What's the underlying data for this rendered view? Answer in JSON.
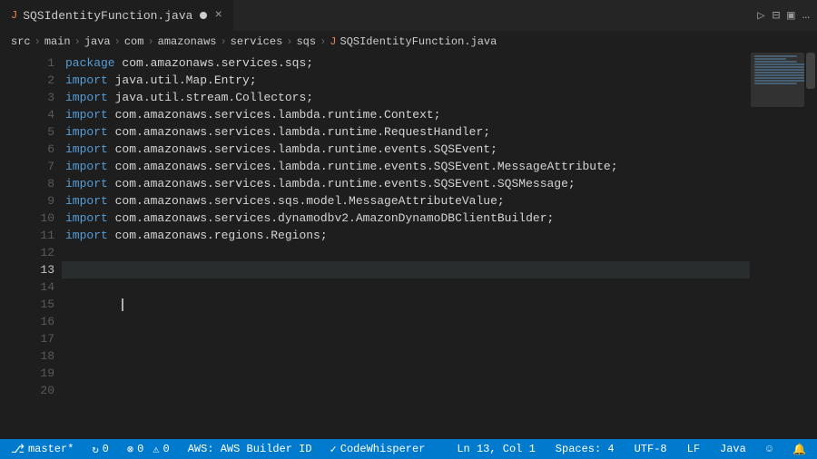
{
  "tab": {
    "filename": "SQSIdentityFunction.java",
    "modified": true,
    "language_icon": "J",
    "close_label": "×"
  },
  "breadcrumb": {
    "parts": [
      "src",
      "main",
      "java",
      "com",
      "amazonaws",
      "services",
      "sqs"
    ],
    "file": "SQSIdentityFunction.java",
    "separators": [
      ">",
      ">",
      ">",
      ">",
      ">",
      ">",
      ">",
      ">"
    ]
  },
  "toolbar": {
    "run_icon": "▷",
    "split_icon": "⊟",
    "layout_icon": "▣",
    "more_icon": "…"
  },
  "code": {
    "lines": [
      {
        "num": 1,
        "content": "package com.amazonaws.services.sqs;",
        "tokens": [
          {
            "t": "kw",
            "v": "package"
          },
          {
            "t": "plain",
            "v": " com.amazonaws.services.sqs;"
          }
        ]
      },
      {
        "num": 2,
        "content": "import java.util.Map.Entry;",
        "tokens": [
          {
            "t": "kw",
            "v": "import"
          },
          {
            "t": "plain",
            "v": " java.util.Map.Entry;"
          }
        ]
      },
      {
        "num": 3,
        "content": "import java.util.stream.Collectors;",
        "tokens": [
          {
            "t": "kw",
            "v": "import"
          },
          {
            "t": "plain",
            "v": " java.util.stream.Collectors;"
          }
        ]
      },
      {
        "num": 4,
        "content": "import com.amazonaws.services.lambda.runtime.Context;",
        "tokens": [
          {
            "t": "kw",
            "v": "import"
          },
          {
            "t": "plain",
            "v": " com.amazonaws.services.lambda.runtime.Context;"
          }
        ]
      },
      {
        "num": 5,
        "content": "import com.amazonaws.services.lambda.runtime.RequestHandler;",
        "tokens": [
          {
            "t": "kw",
            "v": "import"
          },
          {
            "t": "plain",
            "v": " com.amazonaws.services.lambda.runtime.RequestHandler;"
          }
        ]
      },
      {
        "num": 6,
        "content": "import com.amazonaws.services.lambda.runtime.events.SQSEvent;",
        "tokens": [
          {
            "t": "kw",
            "v": "import"
          },
          {
            "t": "plain",
            "v": " com.amazonaws.services.lambda.runtime.events.SQSEvent;"
          }
        ]
      },
      {
        "num": 7,
        "content": "import com.amazonaws.services.lambda.runtime.events.SQSEvent.MessageAttribute;",
        "tokens": [
          {
            "t": "kw",
            "v": "import"
          },
          {
            "t": "plain",
            "v": " com.amazonaws.services.lambda.runtime.events.SQSEvent.MessageAttribute;"
          }
        ]
      },
      {
        "num": 8,
        "content": "import com.amazonaws.services.lambda.runtime.events.SQSEvent.SQSMessage;",
        "tokens": [
          {
            "t": "kw",
            "v": "import"
          },
          {
            "t": "plain",
            "v": " com.amazonaws.services.lambda.runtime.events.SQSEvent.SQSMessage;"
          }
        ]
      },
      {
        "num": 9,
        "content": "import com.amazonaws.services.sqs.model.MessageAttributeValue;",
        "tokens": [
          {
            "t": "kw",
            "v": "import"
          },
          {
            "t": "plain",
            "v": " com.amazonaws.services.sqs.model.MessageAttributeValue;"
          }
        ]
      },
      {
        "num": 10,
        "content": "import com.amazonaws.services.dynamodbv2.AmazonDynamoDBClientBuilder;",
        "tokens": [
          {
            "t": "kw",
            "v": "import"
          },
          {
            "t": "plain",
            "v": " com.amazonaws.services.dynamodbv2.AmazonDynamoDBClientBuilder;"
          }
        ]
      },
      {
        "num": 11,
        "content": "import com.amazonaws.regions.Regions;",
        "tokens": [
          {
            "t": "kw",
            "v": "import"
          },
          {
            "t": "plain",
            "v": " com.amazonaws.regions.Regions;"
          }
        ]
      },
      {
        "num": 12,
        "content": "",
        "tokens": []
      },
      {
        "num": 13,
        "content": "",
        "tokens": [],
        "active": true
      },
      {
        "num": 14,
        "content": "",
        "tokens": []
      },
      {
        "num": 15,
        "content": "",
        "tokens": []
      },
      {
        "num": 16,
        "content": "",
        "tokens": []
      },
      {
        "num": 17,
        "content": "",
        "tokens": []
      },
      {
        "num": 18,
        "content": "",
        "tokens": []
      },
      {
        "num": 19,
        "content": "",
        "tokens": []
      },
      {
        "num": 20,
        "content": "",
        "tokens": []
      }
    ]
  },
  "status_bar": {
    "branch": "master*",
    "sync_icon": "↻",
    "errors": "0",
    "warnings": "0",
    "aws_profile": "AWS: AWS Builder ID",
    "codewhisperer": "CodeWhisperer",
    "cursor_line": "13",
    "cursor_col": "1",
    "spaces": "Spaces: 4",
    "encoding": "UTF-8",
    "line_ending": "LF",
    "language": "Java",
    "bell_icon": "🔔",
    "feedback_icon": "☺"
  }
}
